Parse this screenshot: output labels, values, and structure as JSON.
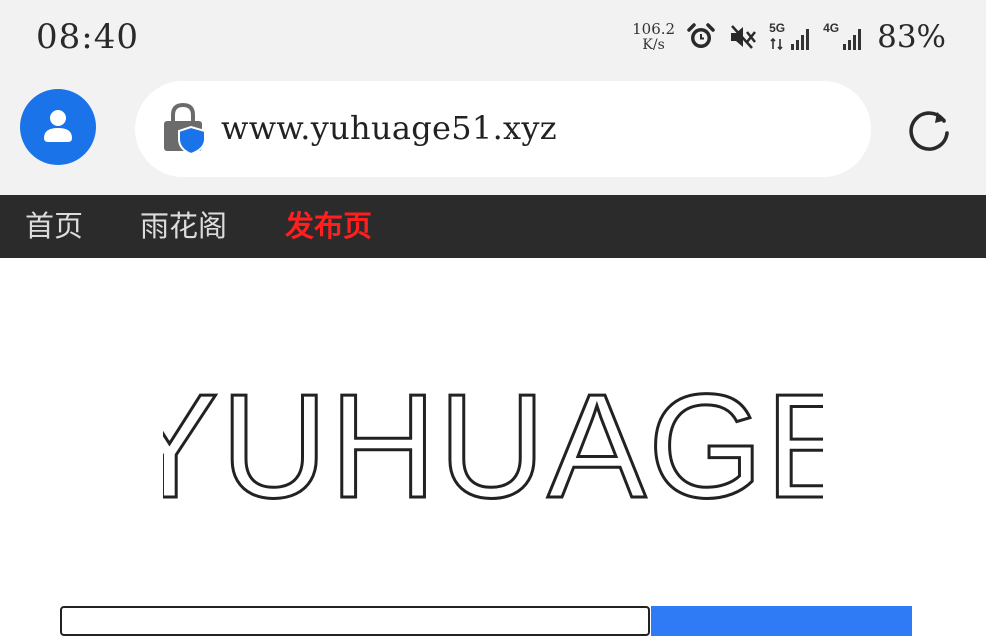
{
  "status_bar": {
    "time": "08:40",
    "net_speed_value": "106.2",
    "net_speed_unit": "K/s",
    "net1_tag": "5G",
    "net2_tag": "4G",
    "battery": "83%",
    "icons": [
      "alarm-icon",
      "mute-icon",
      "signal-5g-icon",
      "signal-4g-icon"
    ]
  },
  "browser": {
    "url": "www.yuhuage51.xyz",
    "accent_color": "#1a73e8"
  },
  "nav": {
    "items": [
      {
        "label": "首页"
      },
      {
        "label": "雨花阁"
      },
      {
        "label": "发布页"
      }
    ],
    "active_color": "#ff1f1f"
  },
  "page": {
    "logo_text": "YUHUAGE"
  }
}
